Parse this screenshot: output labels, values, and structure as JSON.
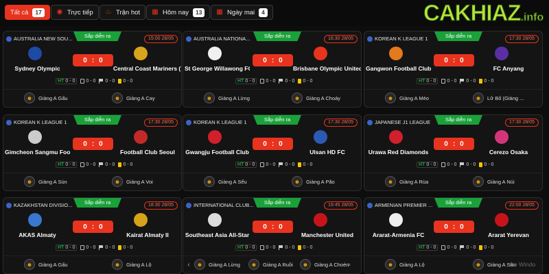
{
  "tabs": [
    {
      "label": "Tất cả",
      "count": "17",
      "icon": "all-icon"
    },
    {
      "label": "Trực tiếp",
      "icon": "live-icon"
    },
    {
      "label": "Trận hot",
      "icon": "fire-icon"
    },
    {
      "label": "Hôm nay",
      "count": "13",
      "icon": "calendar-icon"
    },
    {
      "label": "Ngày mai",
      "count": "4",
      "icon": "calendar-icon"
    }
  ],
  "logo": {
    "main": "CAKHIAZ",
    "domain": ".info"
  },
  "watermark": "ate Windo",
  "colors": {
    "accent": "#e8331e",
    "live_green": "#1aa13a",
    "logo_green": "#b6e23b",
    "yellow_card": "#f2c500"
  },
  "matches": [
    {
      "league": "AUSTRALIA NEW SOU...",
      "status": "Sắp diễn ra",
      "time": "15:00 28/05",
      "home": "Sydney Olympic",
      "away": "Central Coast Mariners (Y...",
      "score_home": "0",
      "score_away": "0",
      "ht": "0 - 0",
      "corners": "0 - 0",
      "flags": "0 - 0",
      "cards": "0 - 0",
      "commentators": [
        "Giàng A Gấu",
        "Giàng A Cay"
      ]
    },
    {
      "league": "AUSTRALIA NATIONA...",
      "status": "Sắp diễn ra",
      "time": "16:30 28/05",
      "home": "St George Willawong FC",
      "away": "Brisbane Olympic United ...",
      "score_home": "0",
      "score_away": "0",
      "ht": "0 - 0",
      "corners": "0 - 0",
      "flags": "0 - 0",
      "cards": "0 - 0",
      "commentators": [
        "Giàng A Lừng",
        "Giàng A Choáy"
      ]
    },
    {
      "league": "KOREAN K LEAGUE 1",
      "status": "Sắp diễn ra",
      "time": "17:30 28/05",
      "home": "Gangwon Football Club",
      "away": "FC Anyang",
      "score_home": "0",
      "score_away": "0",
      "ht": "0 - 0",
      "corners": "0 - 0",
      "flags": "0 - 0",
      "cards": "0 - 0",
      "commentators": [
        "Giàng A Mèo",
        "Lữ Bố (Giàng ..."
      ]
    },
    {
      "league": "KOREAN K LEAGUE 1",
      "status": "Sắp diễn ra",
      "time": "17:30 28/05",
      "home": "Gimcheon Sangmu Footb...",
      "away": "Football Club Seoul",
      "score_home": "0",
      "score_away": "0",
      "ht": "0 - 0",
      "corners": "0 - 0",
      "flags": "0 - 0",
      "cards": "0 - 0",
      "commentators": [
        "Giàng A Sún",
        "Giàng A Voi"
      ]
    },
    {
      "league": "KOREAN K LEAGUE 1",
      "status": "Sắp diễn ra",
      "time": "17:30 28/05",
      "home": "Gwangju Football Club",
      "away": "Ulsan HD FC",
      "score_home": "0",
      "score_away": "0",
      "ht": "0 - 0",
      "corners": "0 - 0",
      "flags": "0 - 0",
      "cards": "0 - 0",
      "commentators": [
        "Giàng A Sếu",
        "Giàng A Pão"
      ]
    },
    {
      "league": "JAPANESE J1 LEAGUE",
      "status": "Sắp diễn ra",
      "time": "17:30 28/05",
      "home": "Urawa Red Diamonds",
      "away": "Cerezo Osaka",
      "score_home": "0",
      "score_away": "0",
      "ht": "0 - 0",
      "corners": "0 - 0",
      "flags": "0 - 0",
      "cards": "0 - 0",
      "commentators": [
        "Giàng A Rùa",
        "Giàng A Núi"
      ]
    },
    {
      "league": "KAZAKHSTAN DIVISIO...",
      "status": "Sắp diễn ra",
      "time": "18:30 28/05",
      "home": "AKAS Almaty",
      "away": "Kairat Almaty II",
      "score_home": "0",
      "score_away": "0",
      "ht": "0 - 0",
      "corners": "0 - 0",
      "flags": "0 - 0",
      "cards": "0 - 0",
      "commentators": [
        "Giàng A Gấu",
        "Giàng A Lộ"
      ]
    },
    {
      "league": "INTERNATIONAL CLUB...",
      "status": "Sắp diễn ra",
      "time": "19:45 28/05",
      "home": "Southeast Asia All-Star",
      "away": "Manchester United",
      "score_home": "0",
      "score_away": "0",
      "ht": "0 - 0",
      "corners": "0 - 0",
      "flags": "0 - 0",
      "cards": "0 - 0",
      "commentators": [
        "Giàng A Lừng",
        "Giàng A Ruồi",
        "Giàng A Choén"
      ]
    },
    {
      "league": "ARMENIAN PREMIER ...",
      "status": "Sắp diễn ra",
      "time": "22:00 28/05",
      "home": "Ararat-Armenia FC",
      "away": "Ararat Yerevan",
      "score_home": "0",
      "score_away": "0",
      "ht": "0 - 0",
      "corners": "0 - 0",
      "flags": "0 - 0",
      "cards": "0 - 0",
      "commentators": [
        "Giàng A Lộ",
        "Giàng A Sâu"
      ]
    }
  ]
}
